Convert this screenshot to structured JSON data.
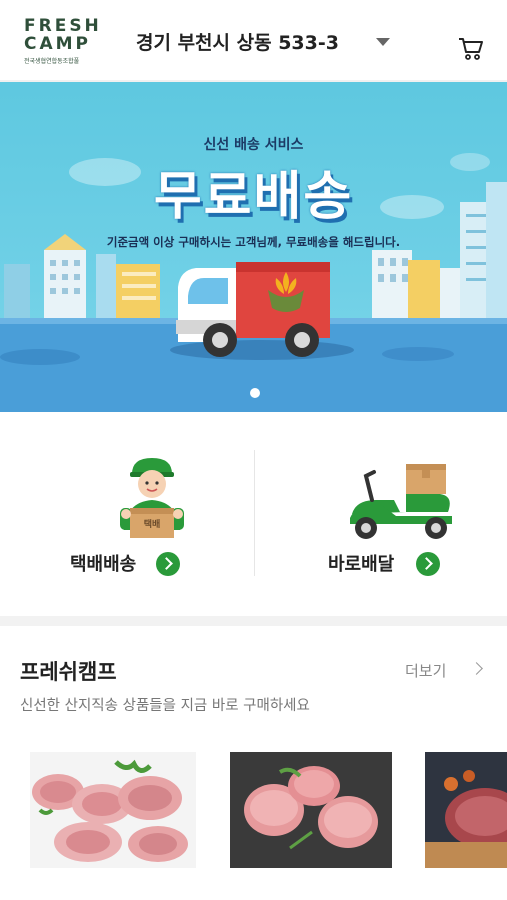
{
  "header": {
    "logo_line1": "FRESH",
    "logo_line2": "CAMP",
    "logo_sub": "전국생협연합동조합풀",
    "location": "경기 부천시 상동 533-3",
    "cart_icon": "cart-icon"
  },
  "banner": {
    "subtitle": "신선 배송 서비스",
    "title": "무료배송",
    "description": "기준금액 이상 구매하시는 고객님께, 무료배송을 해드립니다.",
    "truck_box_label": "",
    "slide_index": 1,
    "colors": {
      "sky": "#5ec8e0",
      "truck_red": "#e0453f",
      "road": "#4a9ed8"
    }
  },
  "delivery": {
    "options": [
      {
        "label": "택배배송",
        "box_label": "택배"
      },
      {
        "label": "바로배달"
      }
    ],
    "accent": "#2a9a3a"
  },
  "section": {
    "title": "프레쉬캠프",
    "more": "더보기",
    "subtitle": "신선한 산지직송 상품들을 지금 바로 구매하세요"
  }
}
